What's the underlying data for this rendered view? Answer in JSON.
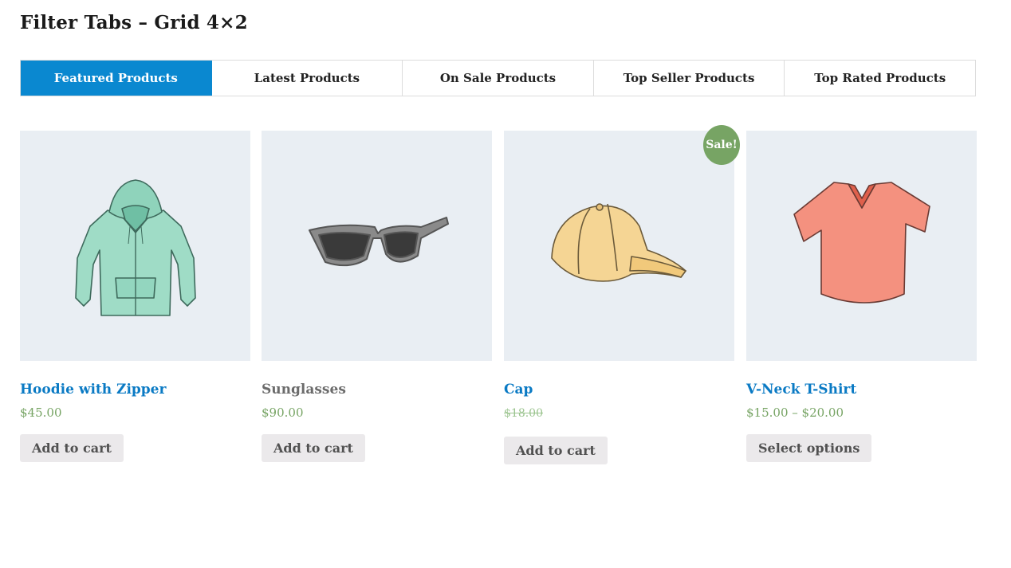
{
  "page": {
    "title": "Filter Tabs – Grid 4×2"
  },
  "tabs": [
    {
      "label": "Featured Products",
      "active": true
    },
    {
      "label": "Latest Products",
      "active": false
    },
    {
      "label": "On Sale Products",
      "active": false
    },
    {
      "label": "Top Seller Products",
      "active": false
    },
    {
      "label": "Top Rated Products",
      "active": false
    }
  ],
  "products": [
    {
      "name": "Hoodie with Zipper",
      "price": "$45.00",
      "button": "Add to cart",
      "image": "hoodie-icon"
    },
    {
      "name": "Sunglasses",
      "price": "$90.00",
      "button": "Add to cart",
      "image": "sunglasses-icon"
    },
    {
      "name": "Cap",
      "regular_price": "$18.00",
      "badge": "Sale!",
      "button": "Add to cart",
      "image": "cap-icon"
    },
    {
      "name": "V-Neck T-Shirt",
      "price": "$15.00 – $20.00",
      "button": "Select options",
      "image": "tshirt-icon"
    }
  ],
  "colors": {
    "accent": "#0a88d0",
    "link": "#0a7ac4",
    "price": "#77a464",
    "sale_badge": "#77a464",
    "thumb_bg": "#e9eef3",
    "button_bg": "#ebe9eb"
  }
}
